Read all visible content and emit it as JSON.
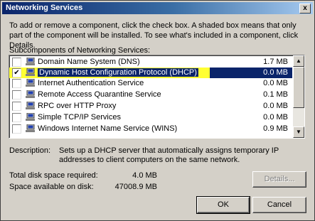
{
  "window": {
    "title": "Networking Services",
    "close_label": "x"
  },
  "intro_text": "To add or remove a component, click the check box. A shaded box means that only part of the component will be installed. To see what's included in a component, click Details.",
  "subcomponents_label": "Subcomponents of Networking Services:",
  "components": [
    {
      "name": "Domain Name System (DNS)",
      "size": "1.7 MB",
      "checked": false
    },
    {
      "name": "Dynamic Host Configuration Protocol (DHCP)",
      "size": "0.0 MB",
      "checked": true
    },
    {
      "name": "Internet Authentication Service",
      "size": "0.0 MB",
      "checked": false
    },
    {
      "name": "Remote Access Quarantine Service",
      "size": "0.1 MB",
      "checked": false
    },
    {
      "name": "RPC over HTTP Proxy",
      "size": "0.0 MB",
      "checked": false
    },
    {
      "name": "Simple TCP/IP Services",
      "size": "0.0 MB",
      "checked": false
    },
    {
      "name": "Windows Internet Name Service (WINS)",
      "size": "0.9 MB",
      "checked": false
    }
  ],
  "description": {
    "label": "Description:",
    "text": "Sets up a DHCP server that automatically assigns temporary IP addresses to client computers on the same network."
  },
  "disk": {
    "total_label": "Total disk space required:",
    "total_value": "4.0 MB",
    "available_label": "Space available on disk:",
    "available_value": "47008.9 MB"
  },
  "buttons": {
    "details": "Details...",
    "ok": "OK",
    "cancel": "Cancel"
  },
  "colors": {
    "highlight": "#ffff33",
    "selection": "#0a246a",
    "title_bar": "#0a246a",
    "dialog_bg": "#d4d0c8"
  },
  "icons": {
    "component": "network-computer-icon",
    "check": "checkmark-icon",
    "close": "close-icon"
  }
}
